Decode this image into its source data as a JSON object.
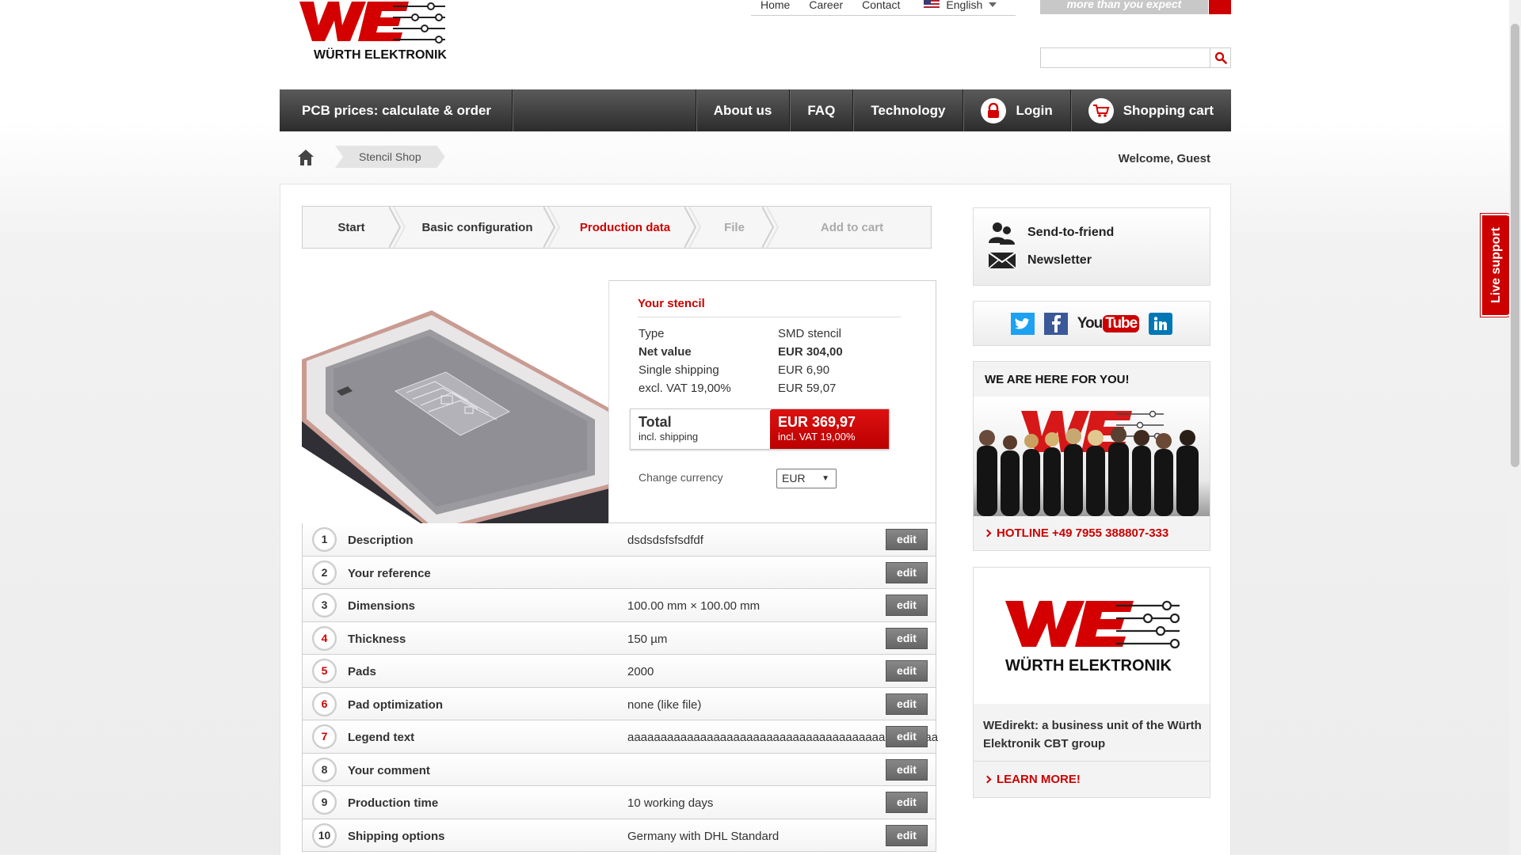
{
  "header": {
    "logo_text": "WÜRTH ELEKTRONIK",
    "top_links": [
      "Home",
      "Career",
      "Contact"
    ],
    "language": "English",
    "slogan": "more than you expect",
    "search": {
      "value": "",
      "placeholder": ""
    }
  },
  "nav": {
    "first": "PCB prices: calculate & order",
    "items": [
      "About us",
      "FAQ",
      "Technology"
    ],
    "login": "Login",
    "cart": "Shopping cart"
  },
  "breadcrumb": {
    "current": "Stencil Shop"
  },
  "welcome": "Welcome, Guest",
  "steps": [
    {
      "label": "Start",
      "state": "done"
    },
    {
      "label": "Basic configuration",
      "state": "done"
    },
    {
      "label": "Production data",
      "state": "active"
    },
    {
      "label": "File",
      "state": "disabled"
    },
    {
      "label": "Add to cart",
      "state": "disabled"
    }
  ],
  "stencil": {
    "title": "Your stencil",
    "rows": [
      {
        "key": "Type",
        "value": "SMD stencil",
        "bold": false
      },
      {
        "key": "Net value",
        "value": "EUR 304,00",
        "bold": true
      },
      {
        "key": "Single shipping",
        "value": "EUR 6,90",
        "bold": false
      },
      {
        "key": "excl. VAT 19,00%",
        "value": "EUR 59,07",
        "bold": false
      }
    ],
    "total_label": "Total",
    "total_sub": "incl. shipping",
    "total_value": "EUR 369,97",
    "total_value_sub": "incl. VAT 19,00%",
    "currency_label": "Change currency",
    "currency": "EUR"
  },
  "config": {
    "edit_label": "edit",
    "rows": [
      {
        "num": "1",
        "label": "Description",
        "value": "dsdsdsfsfsdfdf",
        "red": false
      },
      {
        "num": "2",
        "label": "Your reference",
        "value": "",
        "red": false
      },
      {
        "num": "3",
        "label": "Dimensions",
        "value": "100.00 mm × 100.00 mm",
        "red": false
      },
      {
        "num": "4",
        "label": "Thickness",
        "value": "150 µm",
        "red": true
      },
      {
        "num": "5",
        "label": "Pads",
        "value": "2000",
        "red": true
      },
      {
        "num": "6",
        "label": "Pad optimization",
        "value": "none (like file)",
        "red": true
      },
      {
        "num": "7",
        "label": "Legend text",
        "value": "aaaaaaaaaaaaaaaaaaaaaaaaaaaaaaaaaaaaaaaaaaaaaaa",
        "red": true
      },
      {
        "num": "8",
        "label": "Your comment",
        "value": "",
        "red": false
      },
      {
        "num": "9",
        "label": "Production time",
        "value": "10 working days",
        "red": false
      },
      {
        "num": "10",
        "label": "Shipping options",
        "value": "Germany with DHL Standard",
        "red": false
      }
    ]
  },
  "sidebar": {
    "send_to_friend": "Send-to-friend",
    "newsletter": "Newsletter",
    "social": [
      "twitter",
      "facebook",
      "youtube",
      "linkedin"
    ],
    "youtube_you": "You",
    "youtube_tube": "Tube",
    "here_title": "WE ARE HERE FOR YOU!",
    "hotline": "HOTLINE +49 7955 388807-333",
    "wedirekt_text": "WEdirekt: a business unit of the Würth Elektronik CBT group",
    "learn_more": "LEARN MORE!"
  },
  "live_support": "Live support",
  "colors": {
    "brand_red": "#cc0000",
    "nav_dark": "#2c2c2c"
  }
}
